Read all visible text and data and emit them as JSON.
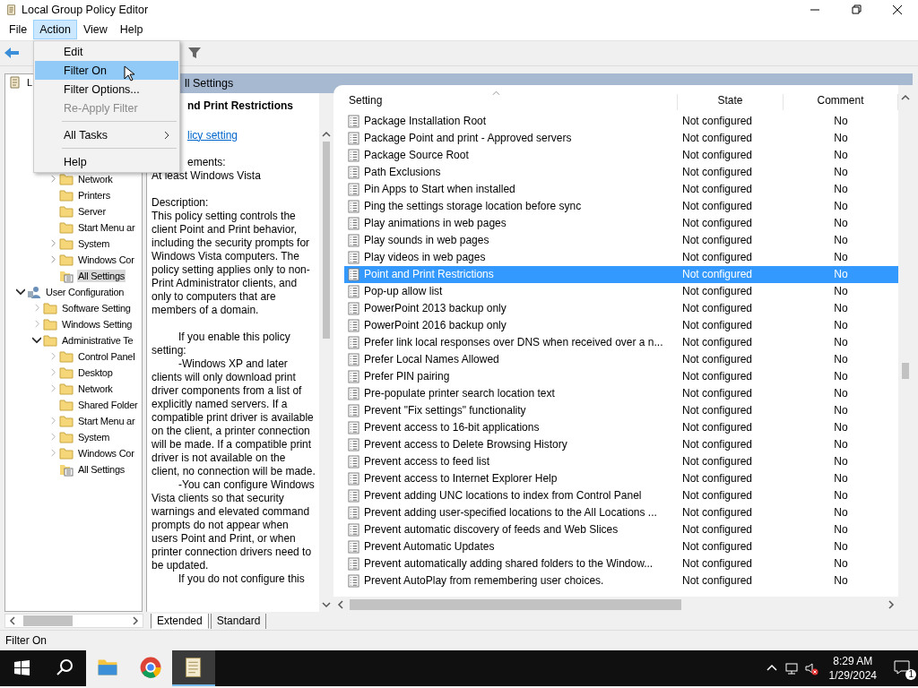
{
  "window": {
    "title": "Local Group Policy Editor"
  },
  "menu_bar": [
    {
      "label": "File",
      "selected": false
    },
    {
      "label": "Action",
      "selected": true
    },
    {
      "label": "View",
      "selected": false
    },
    {
      "label": "Help",
      "selected": false
    }
  ],
  "action_menu": [
    {
      "kind": "item",
      "label": "Edit",
      "highlighted": false,
      "disabled": false
    },
    {
      "kind": "item",
      "label": "Filter On",
      "highlighted": true,
      "disabled": false
    },
    {
      "kind": "item",
      "label": "Filter Options...",
      "highlighted": false,
      "disabled": false
    },
    {
      "kind": "item",
      "label": "Re-Apply Filter",
      "highlighted": false,
      "disabled": true
    },
    {
      "kind": "separator"
    },
    {
      "kind": "submenu",
      "label": "All Tasks",
      "highlighted": false,
      "disabled": false
    },
    {
      "kind": "separator"
    },
    {
      "kind": "item",
      "label": "Help",
      "highlighted": false,
      "disabled": false
    }
  ],
  "tree": {
    "root_label": "L",
    "covered_branch_children": [
      {
        "label": "Network",
        "kind": "folder",
        "has_children": true,
        "selected": false
      },
      {
        "label": "Printers",
        "kind": "folder",
        "has_children": false,
        "selected": false
      },
      {
        "label": "Server",
        "kind": "folder",
        "has_children": false,
        "selected": false
      },
      {
        "label": "Start Menu ar",
        "kind": "folder",
        "has_children": false,
        "selected": false
      },
      {
        "label": "System",
        "kind": "folder",
        "has_children": true,
        "selected": false
      },
      {
        "label": "Windows Cor",
        "kind": "folder",
        "has_children": true,
        "selected": false
      },
      {
        "label": "All Settings",
        "kind": "settings",
        "has_children": false,
        "selected": true
      }
    ],
    "items": [
      {
        "label": "User Configuration",
        "kind": "user",
        "has_children": true,
        "expanded": true,
        "selected": false,
        "children": [
          {
            "label": "Software Setting",
            "kind": "folder",
            "has_children": true,
            "selected": false
          },
          {
            "label": "Windows Setting",
            "kind": "folder",
            "has_children": true,
            "selected": false
          },
          {
            "label": "Administrative Te",
            "kind": "folder",
            "has_children": true,
            "expanded": true,
            "selected": false,
            "children": [
              {
                "label": "Control Panel",
                "kind": "folder",
                "has_children": true,
                "selected": false
              },
              {
                "label": "Desktop",
                "kind": "folder",
                "has_children": true,
                "selected": false
              },
              {
                "label": "Network",
                "kind": "folder",
                "has_children": true,
                "selected": false
              },
              {
                "label": "Shared Folder",
                "kind": "folder",
                "has_children": false,
                "selected": false
              },
              {
                "label": "Start Menu ar",
                "kind": "folder",
                "has_children": true,
                "selected": false
              },
              {
                "label": "System",
                "kind": "folder",
                "has_children": true,
                "selected": false
              },
              {
                "label": "Windows Cor",
                "kind": "folder",
                "has_children": true,
                "selected": false
              },
              {
                "label": "All Settings",
                "kind": "settings",
                "has_children": false,
                "selected": false
              }
            ]
          }
        ]
      }
    ]
  },
  "detail": {
    "header": "ll Settings",
    "title": "nd Print Restrictions",
    "link": "licy setting",
    "requirements_label": "ements:",
    "requirements": "At least Windows Vista",
    "description_label": "Description:",
    "paragraphs": [
      {
        "indent": false,
        "text": "This policy setting controls the client Point and Print behavior, including the security prompts for Windows Vista computers. The policy setting applies only to non-Print Administrator clients, and only to computers that are members of a domain."
      },
      {
        "indent": true,
        "text": "If you enable this policy setting:"
      },
      {
        "indent": true,
        "text": "-Windows XP and later clients will only download print driver components from a list of explicitly named servers. If a compatible print driver is available on the client, a printer connection will be made. If a compatible print driver is not available on the client, no connection will be made."
      },
      {
        "indent": true,
        "text": "-You can configure Windows Vista clients so that security warnings and elevated command prompts do not appear when users Point and Print, or when printer connection drivers need to be updated."
      },
      {
        "indent": true,
        "text": "If you do not configure this"
      }
    ]
  },
  "table": {
    "columns": [
      "Setting",
      "State",
      "Comment"
    ],
    "rows": [
      {
        "setting": "Package Installation Root",
        "state": "Not configured",
        "comment": "No",
        "selected": false
      },
      {
        "setting": "Package Point and print - Approved servers",
        "state": "Not configured",
        "comment": "No",
        "selected": false
      },
      {
        "setting": "Package Source Root",
        "state": "Not configured",
        "comment": "No",
        "selected": false
      },
      {
        "setting": "Path Exclusions",
        "state": "Not configured",
        "comment": "No",
        "selected": false
      },
      {
        "setting": "Pin Apps to Start when installed",
        "state": "Not configured",
        "comment": "No",
        "selected": false
      },
      {
        "setting": "Ping the settings storage location before sync",
        "state": "Not configured",
        "comment": "No",
        "selected": false
      },
      {
        "setting": "Play animations in web pages",
        "state": "Not configured",
        "comment": "No",
        "selected": false
      },
      {
        "setting": "Play sounds in web pages",
        "state": "Not configured",
        "comment": "No",
        "selected": false
      },
      {
        "setting": "Play videos in web pages",
        "state": "Not configured",
        "comment": "No",
        "selected": false
      },
      {
        "setting": "Point and Print Restrictions",
        "state": "Not configured",
        "comment": "No",
        "selected": true
      },
      {
        "setting": "Pop-up allow list",
        "state": "Not configured",
        "comment": "No",
        "selected": false
      },
      {
        "setting": "PowerPoint 2013 backup only",
        "state": "Not configured",
        "comment": "No",
        "selected": false
      },
      {
        "setting": "PowerPoint 2016 backup only",
        "state": "Not configured",
        "comment": "No",
        "selected": false
      },
      {
        "setting": "Prefer link local responses over DNS when received over a n...",
        "state": "Not configured",
        "comment": "No",
        "selected": false
      },
      {
        "setting": "Prefer Local Names Allowed",
        "state": "Not configured",
        "comment": "No",
        "selected": false
      },
      {
        "setting": "Prefer PIN pairing",
        "state": "Not configured",
        "comment": "No",
        "selected": false
      },
      {
        "setting": "Pre-populate printer search location text",
        "state": "Not configured",
        "comment": "No",
        "selected": false
      },
      {
        "setting": "Prevent \"Fix settings\" functionality",
        "state": "Not configured",
        "comment": "No",
        "selected": false
      },
      {
        "setting": "Prevent access to 16-bit applications",
        "state": "Not configured",
        "comment": "No",
        "selected": false
      },
      {
        "setting": "Prevent access to Delete Browsing History",
        "state": "Not configured",
        "comment": "No",
        "selected": false
      },
      {
        "setting": "Prevent access to feed list",
        "state": "Not configured",
        "comment": "No",
        "selected": false
      },
      {
        "setting": "Prevent access to Internet Explorer Help",
        "state": "Not configured",
        "comment": "No",
        "selected": false
      },
      {
        "setting": "Prevent adding UNC locations to index from Control Panel",
        "state": "Not configured",
        "comment": "No",
        "selected": false
      },
      {
        "setting": "Prevent adding user-specified locations to the All Locations ...",
        "state": "Not configured",
        "comment": "No",
        "selected": false
      },
      {
        "setting": "Prevent automatic discovery of feeds and Web Slices",
        "state": "Not configured",
        "comment": "No",
        "selected": false
      },
      {
        "setting": "Prevent Automatic Updates",
        "state": "Not configured",
        "comment": "No",
        "selected": false
      },
      {
        "setting": "Prevent automatically adding shared folders to the Window...",
        "state": "Not configured",
        "comment": "No",
        "selected": false
      },
      {
        "setting": "Prevent AutoPlay from remembering user choices.",
        "state": "Not configured",
        "comment": "No",
        "selected": false
      }
    ]
  },
  "view_tabs": [
    {
      "label": "Extended",
      "selected": true
    },
    {
      "label": "Standard",
      "selected": false
    }
  ],
  "status_bar": "Filter On",
  "taskbar": {
    "apps": [
      {
        "kind": "explorer",
        "active": false
      },
      {
        "kind": "browser",
        "active": false
      },
      {
        "kind": "editor",
        "active": true
      }
    ],
    "time": "8:29 AM",
    "date": "1/29/2024",
    "notifications": "1"
  }
}
